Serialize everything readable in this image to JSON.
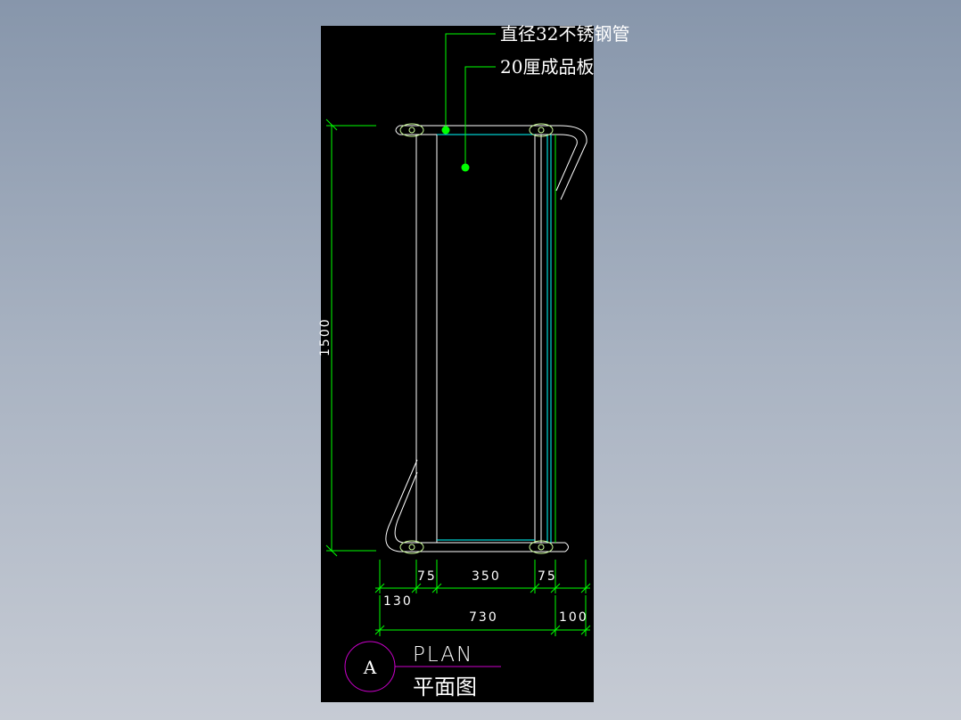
{
  "drawing": {
    "callouts": {
      "pipe_label": "直径32不锈钢管",
      "board_label": "20厘成品板"
    },
    "dimensions": {
      "height": "1500",
      "seg_130": "130",
      "seg_75_left": "75",
      "seg_350": "350",
      "seg_75_right": "75",
      "total_730": "730",
      "seg_100": "100"
    },
    "title_block": {
      "marker": "A",
      "title_en": "PLAN",
      "title_cn": "平面图"
    },
    "colors": {
      "background": "#8796ab",
      "sheet": "#000000",
      "dimension_line": "#00ff00",
      "glass_line": "#00ffff",
      "marker_circle": "#cc00cc",
      "geometry": "#ffffff",
      "leader_dot": "#00ff00",
      "bolt": "#ccff99"
    }
  }
}
